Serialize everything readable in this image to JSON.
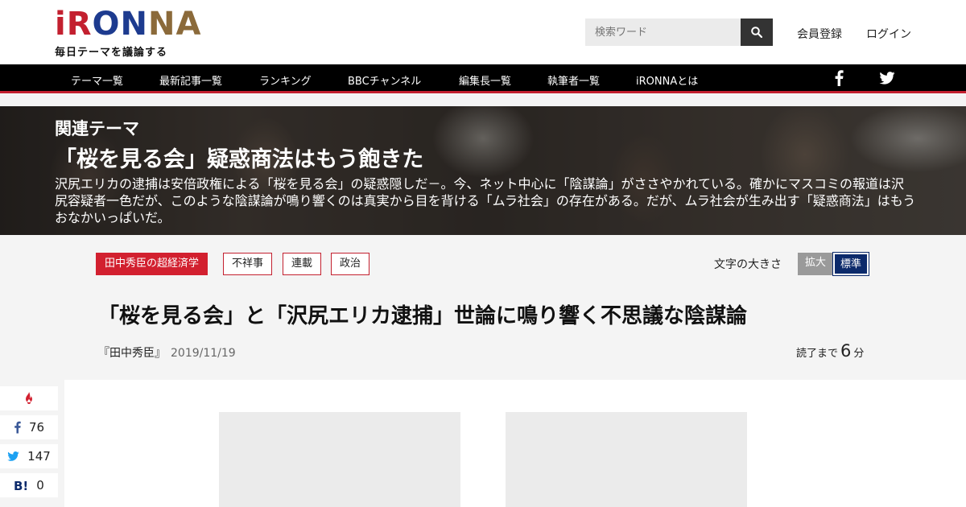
{
  "header": {
    "logo": {
      "letters": [
        {
          "char": "i",
          "color": "#c3202f"
        },
        {
          "char": "R",
          "color": "#c3202f"
        },
        {
          "char": "O",
          "color": "#1d3b8f"
        },
        {
          "char": "N",
          "color": "#1d3b8f"
        },
        {
          "char": "N",
          "color": "#8b6a3a"
        },
        {
          "char": "A",
          "color": "#8b6a3a"
        }
      ],
      "tagline": "毎日テーマを議論する"
    },
    "search": {
      "placeholder": "検索ワード",
      "icon": "search-icon"
    },
    "register_label": "会員登録",
    "login_label": "ログイン"
  },
  "nav": {
    "items": [
      "テーマ一覧",
      "最新記事一覧",
      "ランキング",
      "BBCチャンネル",
      "編集長一覧",
      "執筆者一覧",
      "iRONNAとは"
    ],
    "social": [
      "facebook-icon",
      "twitter-icon"
    ],
    "accent": "#c3202f"
  },
  "hero": {
    "label": "関連テーマ",
    "title": "「桜を見る会」疑惑商法はもう飽きた",
    "description": "沢尻エリカの逮捕は安倍政権による「桜を見る会」の疑惑隠しだ－。今、ネット中心に「陰謀論」がささやかれている。確かにマスコミの報道は沢尻容疑者一色だが、このような陰謀論が鳴り響くのは真実から目を背ける「ムラ社会」の存在がある。だが、ムラ社会が生み出す「疑惑商法」はもうおなかいっぱいだ。"
  },
  "article": {
    "tags": [
      "田中秀臣の超経済学",
      "不祥事",
      "連載",
      "政治"
    ],
    "font_size_label": "文字の大きさ",
    "font_size_options": [
      "拡大",
      "標準"
    ],
    "font_size_selected": "標準",
    "title": "「桜を見る会」と「沢尻エリカ逮捕」世論に鳴り響く不思議な陰謀論",
    "author": "『田中秀臣』",
    "date": "2019/11/19",
    "read_prefix": "読了まで",
    "read_minutes": "6",
    "read_suffix": "分"
  },
  "share": {
    "items": [
      {
        "name": "fire-icon",
        "count": ""
      },
      {
        "name": "facebook-icon",
        "count": "76"
      },
      {
        "name": "twitter-icon",
        "count": "147"
      },
      {
        "name": "hatena-bookmark-icon",
        "count": "0"
      }
    ]
  },
  "colors": {
    "brand_red": "#d2202f",
    "brand_navy": "#0c2a6b",
    "twitter": "#1da1f2",
    "facebook": "#3b5998"
  }
}
